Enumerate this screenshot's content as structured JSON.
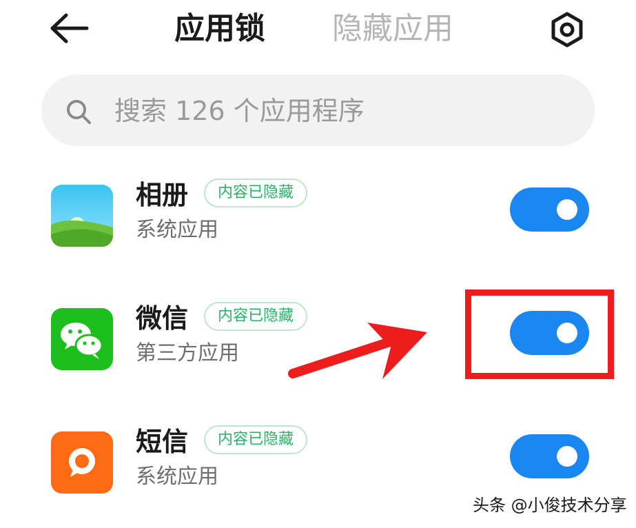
{
  "header": {
    "tabs": [
      {
        "label": "应用锁",
        "active": true
      },
      {
        "label": "隐藏应用",
        "active": false
      }
    ],
    "back_icon": "arrow-left-icon",
    "settings_icon": "hexagon-gear-icon"
  },
  "search": {
    "placeholder": "搜索 126 个应用程序",
    "value": "",
    "icon": "search-icon"
  },
  "apps": [
    {
      "name": "相册",
      "badge": "内容已隐藏",
      "subtitle": "系统应用",
      "icon": "gallery-icon",
      "locked": true
    },
    {
      "name": "微信",
      "badge": "内容已隐藏",
      "subtitle": "第三方应用",
      "icon": "wechat-icon",
      "locked": true
    },
    {
      "name": "短信",
      "badge": "内容已隐藏",
      "subtitle": "系统应用",
      "icon": "messages-icon",
      "locked": true
    }
  ],
  "watermark": "头条 @小俊技术分享",
  "colors": {
    "toggle_on": "#1a86f0",
    "badge_text": "#25b566",
    "annotation_red": "#ee1d1d",
    "inactive_tab": "#b5b5b5"
  }
}
